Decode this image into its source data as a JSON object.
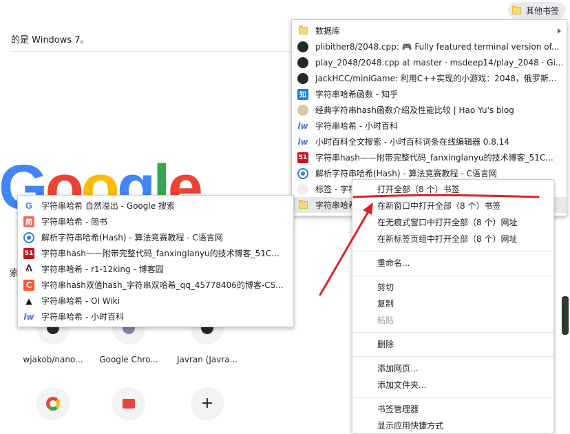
{
  "bookmarks_bar": {
    "other_bookmarks": "其他书签"
  },
  "page": {
    "notice": "的是 Windows 7。",
    "logo_letters": [
      "G",
      "o",
      "o",
      "g",
      "l",
      "e"
    ],
    "side_char": "索",
    "tiles_row1": [
      "wjakob/nano...",
      "Google Chro...",
      "Javran (Javra..."
    ],
    "add_shortcut": "+"
  },
  "other_folder_menu": {
    "items": [
      {
        "label": "数据库",
        "icon": "folder-icon",
        "submenu": true
      },
      {
        "label": "plibither8/2048.cpp: 🎮 Fully featured terminal version of...",
        "icon": "github-icon"
      },
      {
        "label": "play_2048/2048.cpp at master · msdeep14/play_2048 · Gi...",
        "icon": "github-icon"
      },
      {
        "label": "JackHCC/miniGame: 利用C++实现的小游戏：2048，俄罗斯...",
        "icon": "github-icon"
      },
      {
        "label": "字符串哈希函数 - 知乎",
        "icon": "zhihu-icon"
      },
      {
        "label": "经典字符串hash函数介绍及性能比较 | Hao Yu's blog",
        "icon": "haoyu-icon"
      },
      {
        "label": "字符串哈希 - 小时百科",
        "icon": "xiaoshi-icon"
      },
      {
        "label": "小时百科全文搜索 - 小时百科词条在线编辑器 0.8.14",
        "icon": "xiaoshi-icon"
      },
      {
        "label": "字符串hash——附带完整代码_fanxinglanyu的技术博客_51C...",
        "icon": "51cto-icon"
      },
      {
        "label": "解析字符串哈希(Hash) - 算法竞赛教程 - C语言网",
        "icon": "clang-icon"
      },
      {
        "label": "标签 - 字符",
        "icon": "avatar-icon"
      },
      {
        "label": "字符串哈希",
        "icon": "folder-icon",
        "hover": true
      }
    ]
  },
  "hash_folder_menu": {
    "items": [
      {
        "label": "字符串哈希 自然溢出 - Google 搜索",
        "icon": "google-icon"
      },
      {
        "label": "字符串哈希 - 简书",
        "icon": "jianshu-icon"
      },
      {
        "label": "解析字符串哈希(Hash) - 算法竞赛教程 - C语言网",
        "icon": "clang-icon"
      },
      {
        "label": "字符串hash——附带完整代码_fanxinglanyu的技术博客_51C...",
        "icon": "51cto-icon"
      },
      {
        "label": "字符串哈希 - r1-12king - 博客园",
        "icon": "cnblogs-icon"
      },
      {
        "label": "字符串hash双值hash_字符串双哈希_qq_45778406的博客-CS...",
        "icon": "csdn-icon"
      },
      {
        "label": "字符串哈希 - OI Wiki",
        "icon": "oiwiki-icon"
      },
      {
        "label": "字符串哈希 - 小时百科",
        "icon": "xiaoshi-icon"
      }
    ]
  },
  "context_menu": {
    "open_all": "打开全部（8 个）书签",
    "open_all_new_window": "在新窗口中打开全部（8 个）书签",
    "open_all_incognito": "在无痕式窗口中打开全部（8 个）网址",
    "open_all_tab_group": "在新标签页组中打开全部（8 个）网址",
    "rename": "重命名...",
    "cut": "剪切",
    "copy": "复制",
    "paste": "粘贴",
    "delete": "删除",
    "add_page": "添加网页...",
    "add_folder": "添加文件夹...",
    "bookmark_manager": "书签管理器",
    "show_apps_shortcut": "显示应用快捷方式"
  },
  "annotation_color": "#e02020"
}
